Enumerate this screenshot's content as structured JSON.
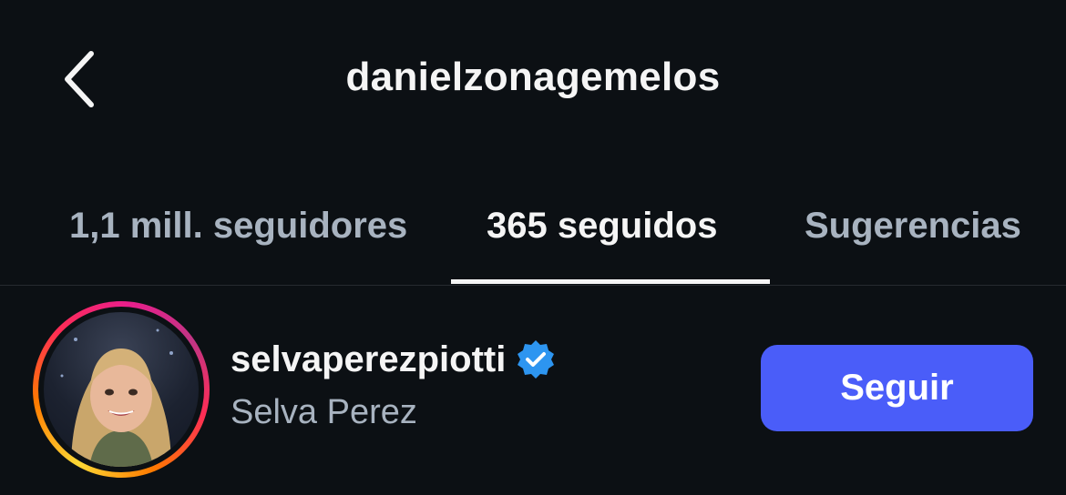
{
  "header": {
    "title": "danielzonagemelos",
    "back_icon": "chevron-left-icon"
  },
  "tabs": [
    {
      "label": "1,1 mill. seguidores",
      "active": false
    },
    {
      "label": "365 seguidos",
      "active": true
    },
    {
      "label": "Sugerencias",
      "active": false
    }
  ],
  "list": [
    {
      "username": "selvaperezpiotti",
      "verified": true,
      "full_name": "Selva Perez",
      "button_label": "Seguir",
      "has_story_ring": true
    }
  ],
  "colors": {
    "background": "#0c1014",
    "primary_text": "#f5f5f5",
    "secondary_text": "#a8b3c0",
    "follow_button": "#4a5df9",
    "verified_badge": "#2d95f0"
  }
}
